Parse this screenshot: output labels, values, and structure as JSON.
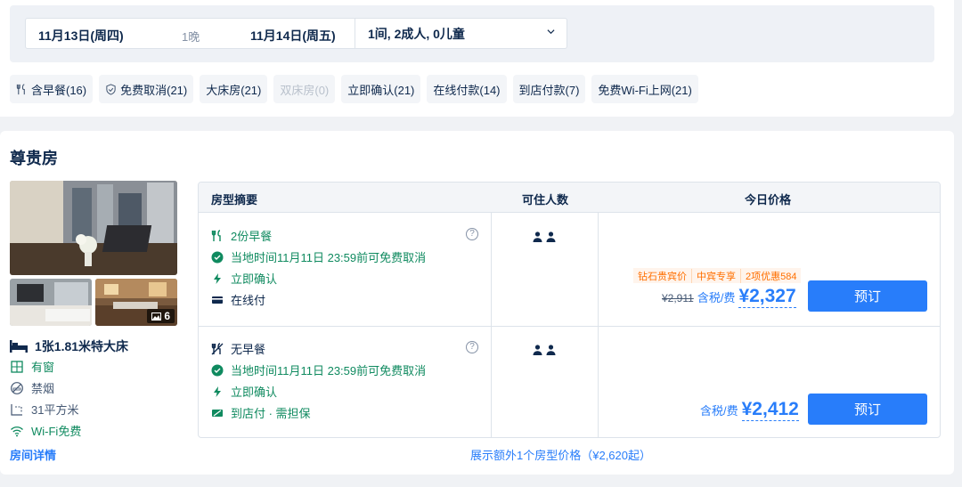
{
  "search": {
    "checkin": "11月13日(周四)",
    "nights": "1晚",
    "checkout": "11月14日(周五)",
    "guests": "1间, 2成人, 0儿童"
  },
  "filters": [
    {
      "label": "含早餐(16)",
      "icon": "utensils-icon",
      "disabled": false
    },
    {
      "label": "免费取消(21)",
      "icon": "shield-check-icon",
      "disabled": false
    },
    {
      "label": "大床房(21)",
      "disabled": false
    },
    {
      "label": "双床房(0)",
      "disabled": true
    },
    {
      "label": "立即确认(21)",
      "disabled": false
    },
    {
      "label": "在线付款(14)",
      "disabled": false
    },
    {
      "label": "到店付款(7)",
      "disabled": false
    },
    {
      "label": "免费Wi-Fi上网(21)",
      "disabled": false
    }
  ],
  "room": {
    "title": "尊贵房",
    "photo_count": "6",
    "bed": "1张1.81米特大床",
    "attributes": [
      "有窗",
      "禁烟",
      "31平方米",
      "Wi-Fi免费"
    ],
    "detail_link": "房间详情"
  },
  "table": {
    "headers": [
      "房型摘要",
      "可住人数",
      "今日价格"
    ],
    "rows": [
      {
        "features": [
          "2份早餐",
          "当地时间11月11日 23:59前可免费取消",
          "立即确认",
          "在线付"
        ],
        "promo": [
          "钻石贵宾价",
          "中宾专享",
          "2项优惠584"
        ],
        "original_price": "¥2,911",
        "tax_label": "含税/费",
        "price": "¥2,327",
        "book_label": "预订"
      },
      {
        "features": [
          "无早餐",
          "当地时间11月11日 23:59前可免费取消",
          "立即确认",
          "到店付 · 需担保"
        ],
        "tax_label": "含税/费",
        "price": "¥2,412",
        "book_label": "预订"
      }
    ],
    "more_link": "展示额外1个房型价格（¥2,620起）"
  },
  "colors": {
    "primary": "#287dfa",
    "green": "#0f8a5f",
    "promo": "#ff6f00",
    "text": "#0f294d"
  }
}
